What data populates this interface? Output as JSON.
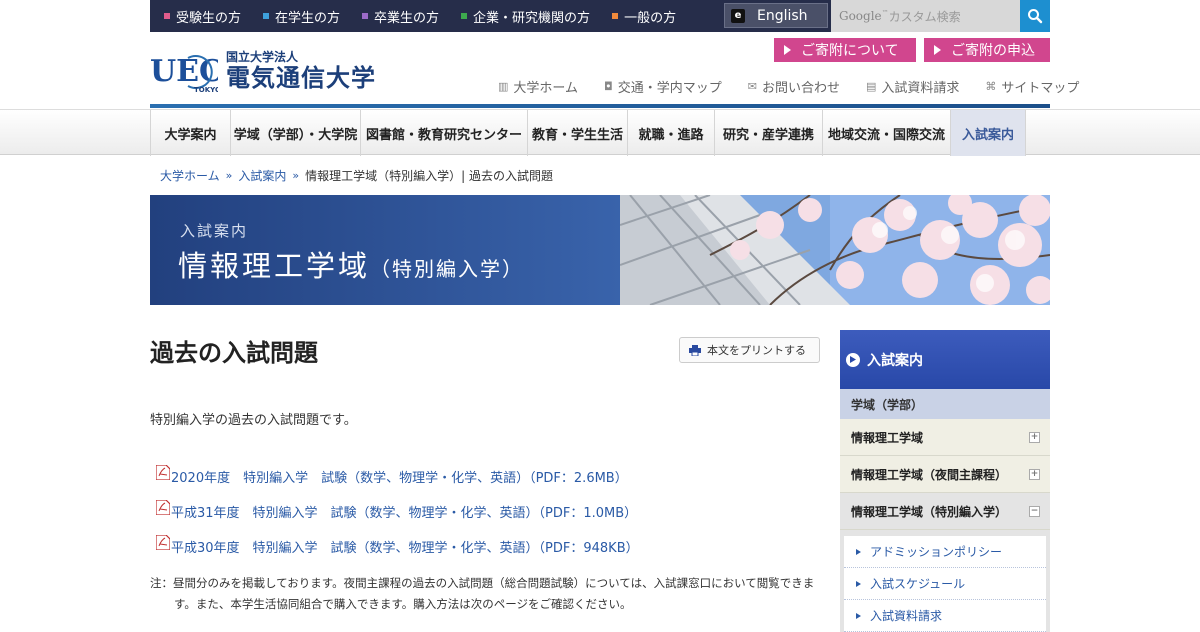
{
  "top_bar": {
    "audiences": [
      {
        "label": "受験生の方",
        "color": "#e05c8c"
      },
      {
        "label": "在学生の方",
        "color": "#3ea0dc"
      },
      {
        "label": "卒業生の方",
        "color": "#9b6bc8"
      },
      {
        "label": "企業・研究機関の方",
        "color": "#3daa4e"
      },
      {
        "label": "一般の方",
        "color": "#f08a3c"
      }
    ],
    "english_label": "English",
    "search_placeholder_brand": "Google",
    "search_placeholder_tm": "™",
    "search_placeholder": "カスタム検索"
  },
  "donation": {
    "about_label": "ご寄附について",
    "apply_label": "ご寄附の申込"
  },
  "logo": {
    "mark_text": "UEC",
    "mark_sub": "TOKYO",
    "sub_text": "国立大学法人",
    "main_text": "電気通信大学"
  },
  "utility_nav": [
    {
      "icon": "building-icon",
      "glyph": "▥",
      "label": "大学ホーム"
    },
    {
      "icon": "bus-icon",
      "glyph": "◘",
      "label": "交通・学内マップ"
    },
    {
      "icon": "mail-icon",
      "glyph": "✉",
      "label": "お問い合わせ"
    },
    {
      "icon": "document-icon",
      "glyph": "▤",
      "label": "入試資料請求"
    },
    {
      "icon": "sitemap-icon",
      "glyph": "⌘",
      "label": "サイトマップ"
    }
  ],
  "global_nav": [
    {
      "label": "大学案内",
      "active": false
    },
    {
      "label": "学域（学部）・大学院",
      "active": false
    },
    {
      "label": "図書館・教育研究センター",
      "active": false
    },
    {
      "label": "教育・学生生活",
      "active": false
    },
    {
      "label": "就職・進路",
      "active": false
    },
    {
      "label": "研究・産学連携",
      "active": false
    },
    {
      "label": "地域交流・国際交流",
      "active": false
    },
    {
      "label": "入試案内",
      "active": true
    }
  ],
  "breadcrumb": {
    "home": "大学ホーム",
    "admissions": "入試案内",
    "current": "情報理工学域（特別編入学）| 過去の入試問題"
  },
  "hero": {
    "subtitle": "入試案内",
    "title": "情報理工学域",
    "title_suffix": "（特別編入学）"
  },
  "main": {
    "title": "過去の入試問題",
    "print_label": "本文をプリントする",
    "intro": "特別編入学の過去の入試問題です。",
    "documents": [
      "2020年度　特別編入学　試験（数学、物理学・化学、英語）（PDF：2.6MB）",
      "平成31年度　特別編入学　試験（数学、物理学・化学、英語）（PDF：1.0MB）",
      "平成30年度　特別編入学　試験（数学、物理学・化学、英語）（PDF：948KB）"
    ],
    "note": "注：昼間分のみを掲載しております。夜間主課程の過去の入試問題（総合問題試験）については、入試課窓口において閲覧できます。また、本学生活協同組合で購入できます。購入方法は次のページをご確認ください。"
  },
  "sidebar": {
    "heading": "入試案内",
    "category": "学域（学部）",
    "items": [
      {
        "label": "情報理工学域",
        "toggle": "+"
      },
      {
        "label": "情報理工学域（夜間主課程）",
        "toggle": "+"
      },
      {
        "label": "情報理工学域（特別編入学）",
        "toggle": "−"
      }
    ],
    "subitems": [
      "アドミッションポリシー",
      "入試スケジュール",
      "入試資料請求"
    ]
  },
  "colors": {
    "topbar_bg": "#262d4a",
    "donate_pink": "#d1468e",
    "link_blue": "#2a5aa6",
    "sidebar_head": "#2848a8"
  }
}
